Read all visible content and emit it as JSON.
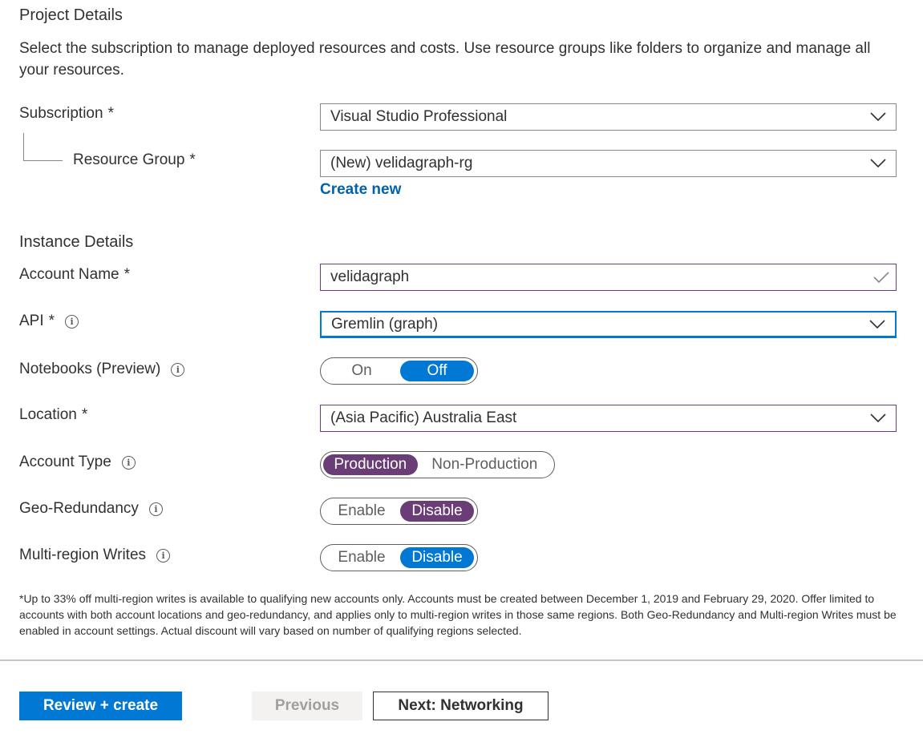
{
  "project": {
    "heading": "Project Details",
    "description": "Select the subscription to manage deployed resources and costs. Use resource groups like folders to organize and manage all your resources.",
    "subscription": {
      "label": "Subscription",
      "required": "*",
      "value": "Visual Studio Professional"
    },
    "resource_group": {
      "label": "Resource Group",
      "required": "*",
      "value": "(New) velidagraph-rg",
      "create_new": "Create new"
    }
  },
  "instance": {
    "heading": "Instance Details",
    "account_name": {
      "label": "Account Name",
      "required": "*",
      "value": "velidagraph"
    },
    "api": {
      "label": "API",
      "required": "*",
      "value": "Gremlin (graph)"
    },
    "notebooks": {
      "label": "Notebooks (Preview)",
      "options": [
        "On",
        "Off"
      ],
      "selected": "Off"
    },
    "location": {
      "label": "Location",
      "required": "*",
      "value": "(Asia Pacific) Australia East"
    },
    "account_type": {
      "label": "Account Type",
      "options": [
        "Production",
        "Non-Production"
      ],
      "selected": "Production"
    },
    "geo_redundancy": {
      "label": "Geo-Redundancy",
      "options": [
        "Enable",
        "Disable"
      ],
      "selected": "Disable"
    },
    "multi_region": {
      "label": "Multi-region Writes",
      "options": [
        "Enable",
        "Disable"
      ],
      "selected": "Disable"
    }
  },
  "footnote": "*Up to 33% off multi-region writes is available to qualifying new accounts only. Accounts must be created between December 1, 2019 and February 29, 2020. Offer limited to accounts with both account locations and geo-redundancy, and applies only to multi-region writes in those same regions. Both Geo-Redundancy and Multi-region Writes must be enabled in account settings. Actual discount will vary based on number of qualifying regions selected.",
  "footer": {
    "review_create": "Review + create",
    "previous": "Previous",
    "next": "Next: Networking"
  },
  "colors": {
    "accent_blue": "#0078d4",
    "accent_purple": "#6b3d76",
    "link": "#0062ad"
  },
  "icons": {
    "dropdown": "chevron-down-icon",
    "valid": "checkmark-icon",
    "info": "info-icon"
  }
}
